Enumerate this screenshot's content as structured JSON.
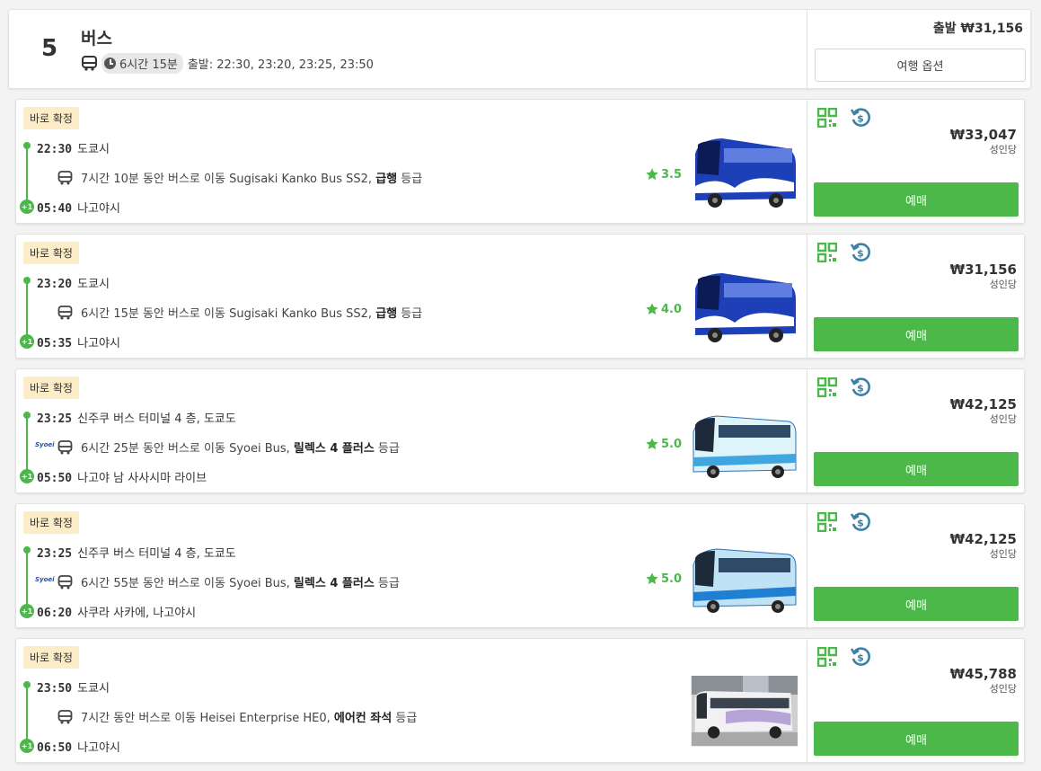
{
  "summary": {
    "count": "5",
    "mode_title": "버스",
    "duration": "6시간 15분",
    "departures": "출발: 22:30, 23:20, 23:25, 23:50",
    "from_price": "출발 ₩31,156",
    "options_label": "여행 옵션"
  },
  "common": {
    "badge": "바로 확정",
    "per_person": "성인당",
    "book_label": "예매",
    "plus_day": "+1"
  },
  "trips": [
    {
      "dep_time": "22:30",
      "dep_place": "도쿄시",
      "ride_text": "7시간 10분 동안 버스로 이동 Sugisaki Kanko Bus SS2,",
      "class_name": "급행",
      "class_suffix": "등급",
      "rating": "3.5",
      "arr_time": "05:40",
      "arr_place": "나고야시",
      "price": "₩33,047"
    },
    {
      "dep_time": "23:20",
      "dep_place": "도쿄시",
      "ride_text": "6시간 15분 동안 버스로 이동 Sugisaki Kanko Bus SS2,",
      "class_name": "급행",
      "class_suffix": "등급",
      "rating": "4.0",
      "arr_time": "05:35",
      "arr_place": "나고야시",
      "price": "₩31,156"
    },
    {
      "dep_time": "23:25",
      "dep_place": "신주쿠 버스 터미널 4 층, 도쿄도",
      "ride_text": "6시간 25분 동안 버스로 이동 Syoei Bus,",
      "class_name": "릴렉스 4 플러스",
      "class_suffix": "등급",
      "rating": "5.0",
      "operator_logo": "Syoei",
      "arr_time": "05:50",
      "arr_place": "나고야 남 사사시마 라이브",
      "price": "₩42,125"
    },
    {
      "dep_time": "23:25",
      "dep_place": "신주쿠 버스 터미널 4 층, 도쿄도",
      "ride_text": "6시간 55분 동안 버스로 이동 Syoei Bus,",
      "class_name": "릴렉스 4 플러스",
      "class_suffix": "등급",
      "rating": "5.0",
      "operator_logo": "Syoei",
      "arr_time": "06:20",
      "arr_place": "사쿠라 사카에, 나고야시",
      "price": "₩42,125"
    },
    {
      "dep_time": "23:50",
      "dep_place": "도쿄시",
      "ride_text": "7시간 동안 버스로 이동 Heisei Enterprise HE0,",
      "class_name": "에어컨 좌석",
      "class_suffix": "등급",
      "arr_time": "06:50",
      "arr_place": "나고야시",
      "price": "₩45,788"
    }
  ],
  "colors": {
    "green": "#4cb84a",
    "badge_bg": "#fdecc8",
    "refund_blue": "#3d7fa6"
  }
}
